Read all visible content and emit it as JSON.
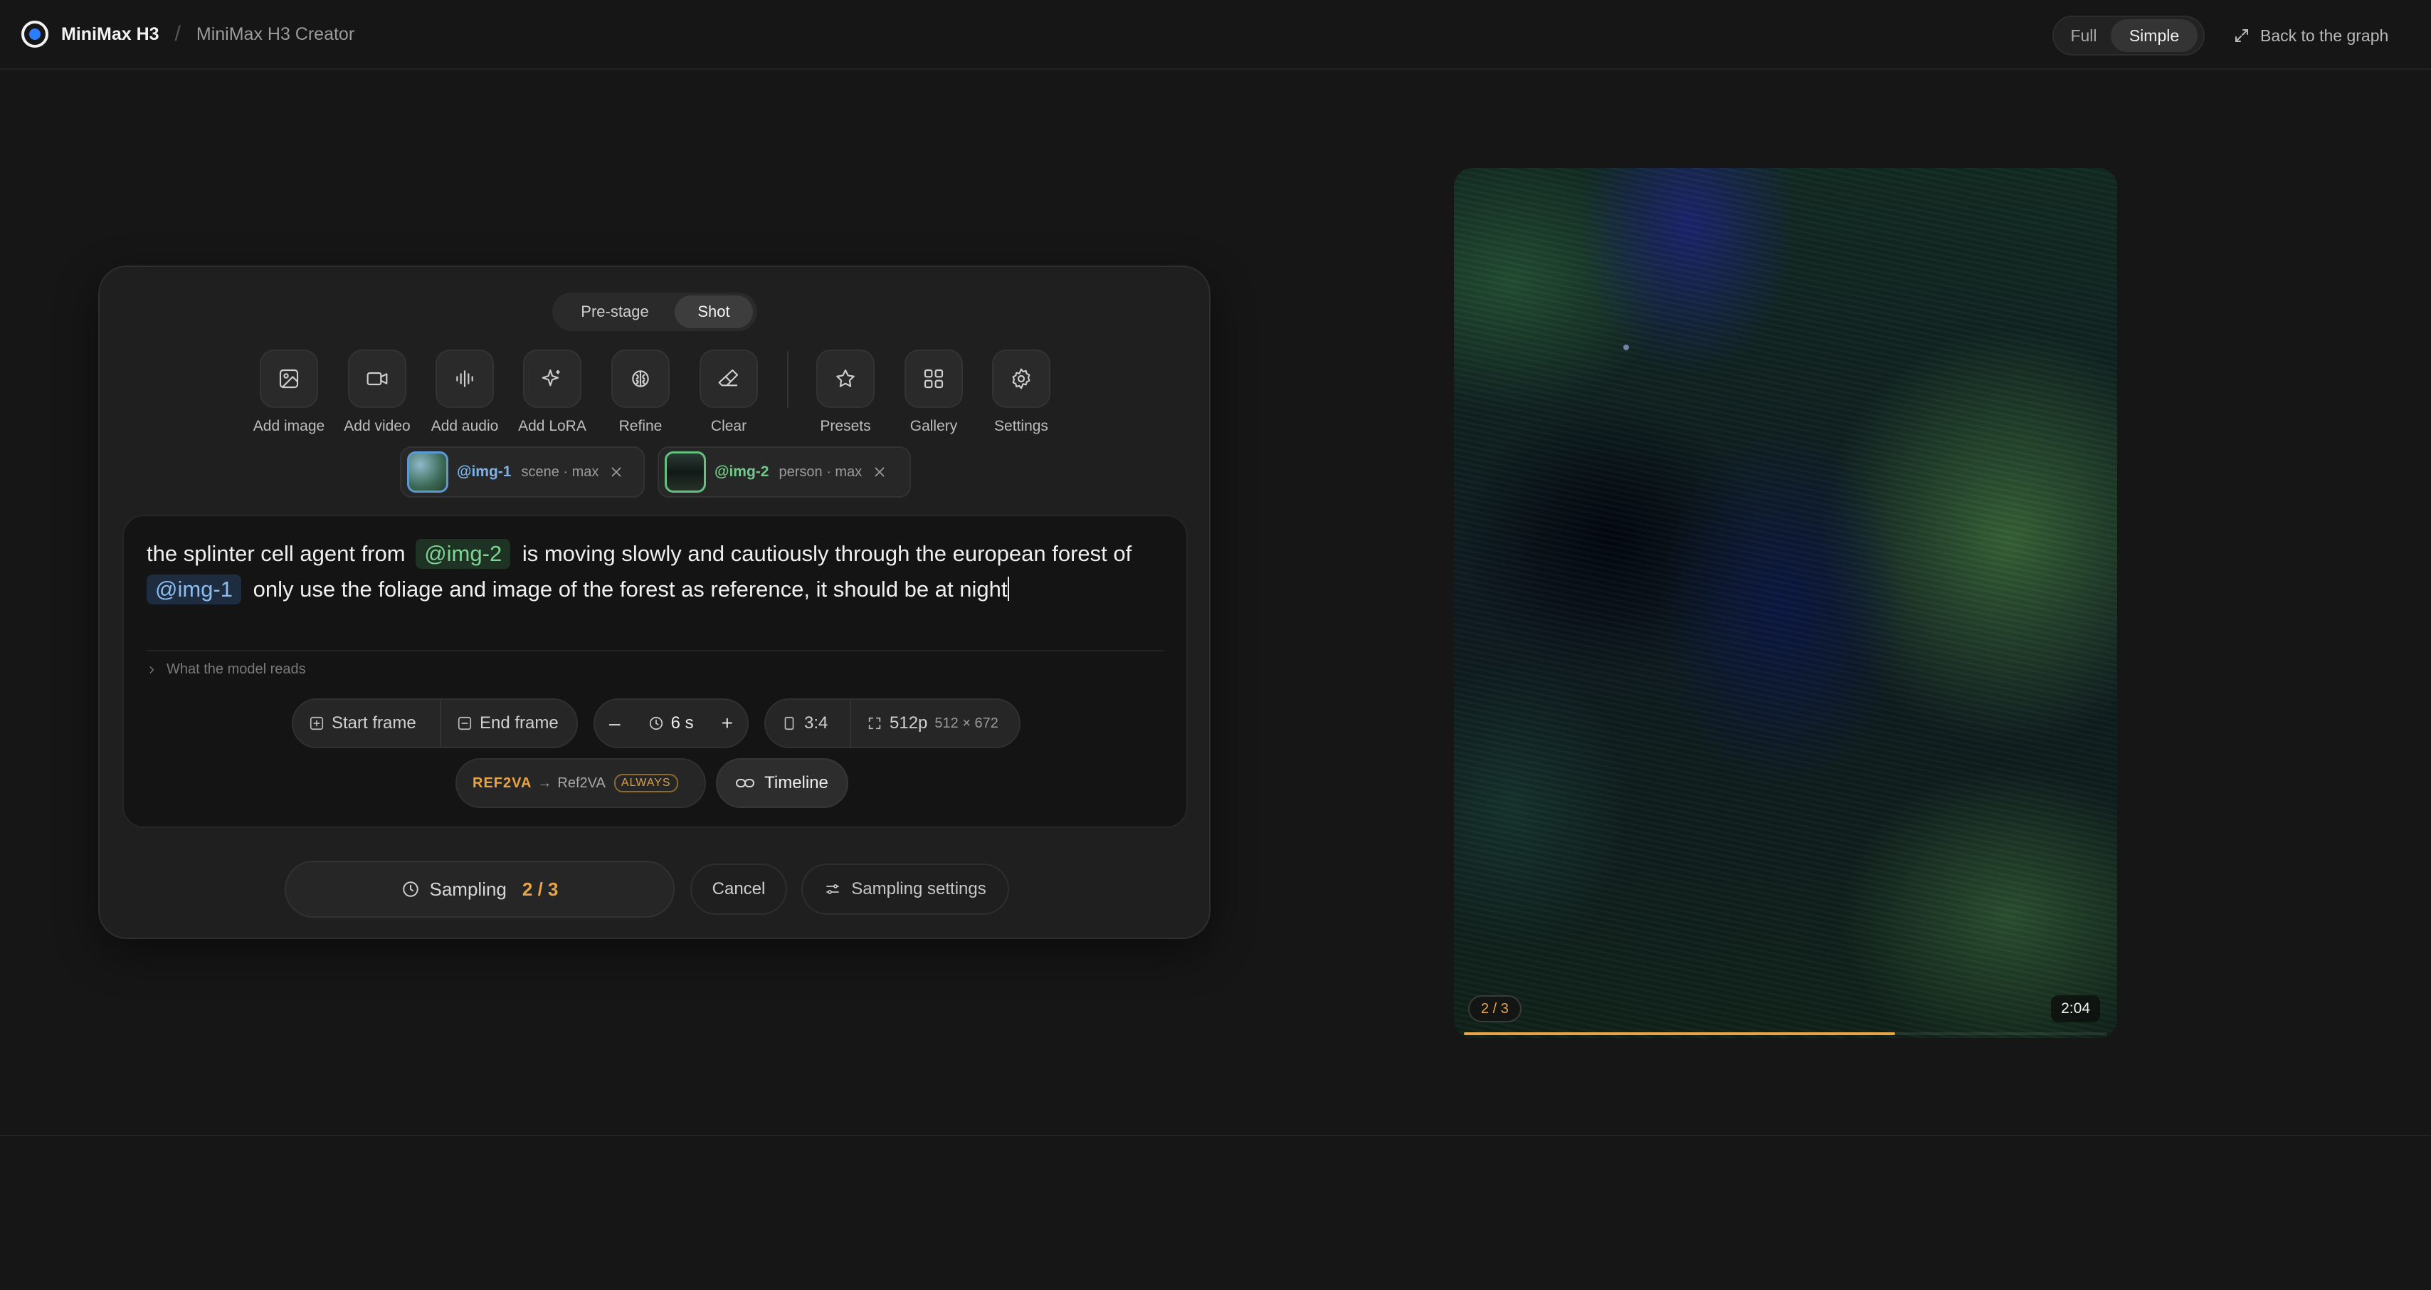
{
  "topbar": {
    "brand": "MiniMax H3",
    "separator": "/",
    "crumb": "MiniMax H3 Creator",
    "modes": [
      {
        "label": "Full",
        "active": false
      },
      {
        "label": "Simple",
        "active": true
      }
    ],
    "back_link": "Back to the graph"
  },
  "composer": {
    "stages": [
      {
        "label": "Pre-stage",
        "active": false
      },
      {
        "label": "Shot",
        "active": true
      }
    ],
    "tools": [
      {
        "label": "Add image",
        "icon": "image-icon"
      },
      {
        "label": "Add video",
        "icon": "video-icon"
      },
      {
        "label": "Add audio",
        "icon": "audio-wave-icon"
      },
      {
        "label": "Add LoRA",
        "icon": "sparkle-icon"
      },
      {
        "label": "Refine",
        "icon": "brain-icon"
      },
      {
        "label": "Clear",
        "icon": "eraser-icon"
      },
      {
        "label": "Presets",
        "icon": "star-icon"
      },
      {
        "label": "Gallery",
        "icon": "grid-icon"
      },
      {
        "label": "Settings",
        "icon": "gear-icon"
      }
    ],
    "references": [
      {
        "tag": "@img-1",
        "meta": "scene · max",
        "color": "#7fb3e8"
      },
      {
        "tag": "@img-2",
        "meta": "person · max",
        "color": "#74c98a"
      }
    ],
    "prompt": {
      "part1": "the splinter cell agent from",
      "mention1": "@img-2",
      "part2": "is moving slowly and cautiously through the european forest of",
      "mention2": "@img-1",
      "part3": "only use the foliage and image of the forest as reference, it should be at night"
    },
    "model_reads": "What the model reads",
    "frames": {
      "start": "Start frame",
      "end": "End frame"
    },
    "duration": {
      "minus": "–",
      "value": "6 s",
      "plus": "+"
    },
    "aspect": "3:4",
    "resolution": {
      "label": "512p",
      "dims": "512 × 672"
    },
    "ref_mode": {
      "key": "REF2VA",
      "arrow": "→",
      "value": "Ref2VA",
      "badge": "ALWAYS"
    },
    "timeline": "Timeline",
    "sampling": {
      "label": "Sampling",
      "count": "2 / 3"
    },
    "cancel": "Cancel",
    "sampling_settings": "Sampling settings"
  },
  "preview": {
    "badge": "2 / 3",
    "time": "2:04",
    "progress": 0.67,
    "accent": "#e8a545"
  }
}
